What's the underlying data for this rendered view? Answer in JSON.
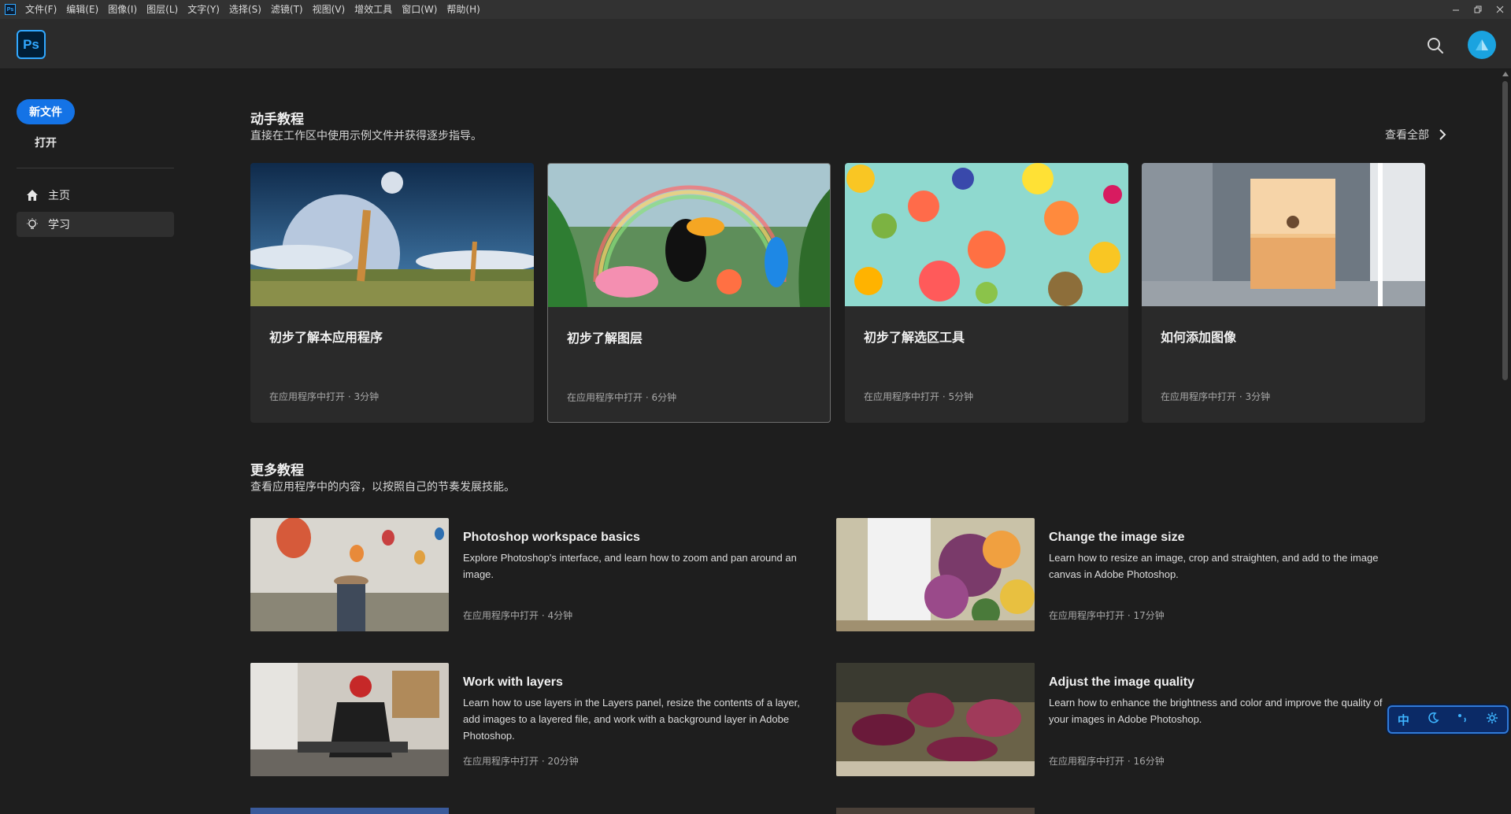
{
  "menubar": {
    "app_icon": "Ps",
    "items": [
      "文件(F)",
      "编辑(E)",
      "图像(I)",
      "图层(L)",
      "文字(Y)",
      "选择(S)",
      "滤镜(T)",
      "视图(V)",
      "增效工具",
      "窗口(W)",
      "帮助(H)"
    ]
  },
  "header": {
    "logo": "Ps"
  },
  "sidebar": {
    "new_file": "新文件",
    "open": "打开",
    "nav": [
      {
        "label": "主页",
        "icon": "home-icon"
      },
      {
        "label": "学习",
        "icon": "lightbulb-icon"
      }
    ]
  },
  "hands_on": {
    "title": "动手教程",
    "subtitle": "直接在工作区中使用示例文件并获得逐步指导。",
    "view_all": "查看全部",
    "cards": [
      {
        "title": "初步了解本应用程序",
        "meta": "在应用程序中打开 · 3分钟"
      },
      {
        "title": "初步了解图层",
        "meta": "在应用程序中打开 · 6分钟"
      },
      {
        "title": "初步了解选区工具",
        "meta": "在应用程序中打开 · 5分钟"
      },
      {
        "title": "如何添加图像",
        "meta": "在应用程序中打开 · 3分钟"
      }
    ]
  },
  "more": {
    "title": "更多教程",
    "subtitle": "查看应用程序中的内容，以按照自己的节奏发展技能。",
    "lessons": [
      {
        "title": "Photoshop workspace basics",
        "desc": "Explore Photoshop's interface, and learn how to zoom and pan around an image.",
        "meta": "在应用程序中打开 · 4分钟"
      },
      {
        "title": "Change the image size",
        "desc": "Learn how to resize an image, crop and straighten, and add to the image canvas in Adobe Photoshop.",
        "meta": "在应用程序中打开 · 17分钟"
      },
      {
        "title": "Work with layers",
        "desc": "Learn how to use layers in the Layers panel, resize the contents of a layer, add images to a layered file, and work with a background layer in Adobe Photoshop.",
        "meta": "在应用程序中打开 · 20分钟"
      },
      {
        "title": "Adjust the image quality",
        "desc": "Learn how to enhance the brightness and color and improve the quality of your images in Adobe Photoshop.",
        "meta": "在应用程序中打开 · 16分钟"
      }
    ]
  },
  "ime": {
    "mode": "中"
  },
  "colors": {
    "accent": "#1473e6",
    "ps_blue": "#31a8ff",
    "background": "#1e1e1e"
  }
}
